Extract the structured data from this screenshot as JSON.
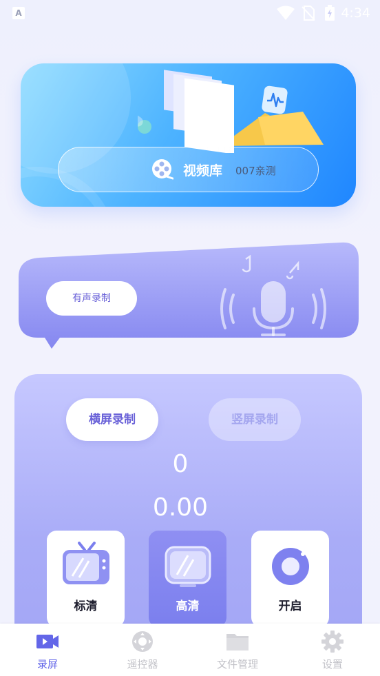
{
  "status_bar": {
    "time": "4:34",
    "notification_icon": "A"
  },
  "video_library": {
    "title": "视频库",
    "subtitle": "007亲测"
  },
  "sound_banner": {
    "toggle_label": "有声录制"
  },
  "recording": {
    "modes": [
      "横屏录制",
      "竖屏录制"
    ],
    "selected_mode": "横屏录制",
    "counter": "0",
    "size": "0.00",
    "quality_options": [
      {
        "label": "标清",
        "icon": "tv-icon"
      },
      {
        "label": "高清",
        "icon": "monitor-icon"
      },
      {
        "label": "开启",
        "icon": "record-toggle-icon"
      }
    ],
    "selected_quality": "高清"
  },
  "bottom_nav": {
    "items": [
      {
        "label": "录屏",
        "icon": "video-camera-icon",
        "active": true
      },
      {
        "label": "遥控器",
        "icon": "remote-control-icon",
        "active": false
      },
      {
        "label": "文件管理",
        "icon": "folder-icon",
        "active": false
      },
      {
        "label": "设置",
        "icon": "gear-icon",
        "active": false
      }
    ]
  },
  "colors": {
    "accent": "#6366e8",
    "card_blue": "#1f86ff",
    "panel": "#a9acf7"
  }
}
